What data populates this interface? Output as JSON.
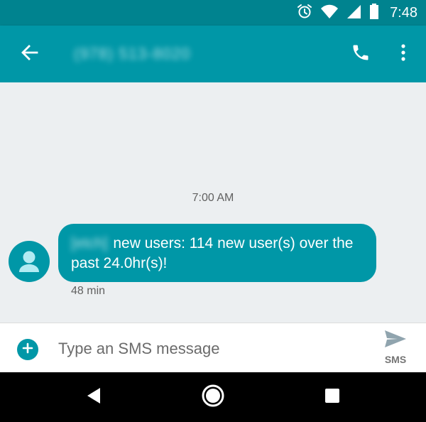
{
  "status_bar": {
    "time": "7:48",
    "icons": [
      "alarm-icon",
      "wifi-icon",
      "cell-signal-icon",
      "battery-icon"
    ]
  },
  "app_bar": {
    "contact": "(978) 513-8020",
    "icons": [
      "back-arrow-icon",
      "phone-icon",
      "more-vert-icon"
    ]
  },
  "conversation": {
    "timestamp": "7:00 AM",
    "message": {
      "sender_tag": "[etch]",
      "text": "new users: 114 new user(s) over the past 24.0hr(s)!",
      "age": "48 min"
    }
  },
  "composer": {
    "placeholder": "Type an SMS message",
    "value": "",
    "send_label": "SMS"
  },
  "nav_bar": {
    "icons": [
      "nav-back-icon",
      "nav-home-icon",
      "nav-recents-icon"
    ]
  },
  "colors": {
    "status_bar": "#00838f",
    "app_bar": "#0097a7",
    "bubble": "#0097a7",
    "background": "#eceff1"
  }
}
